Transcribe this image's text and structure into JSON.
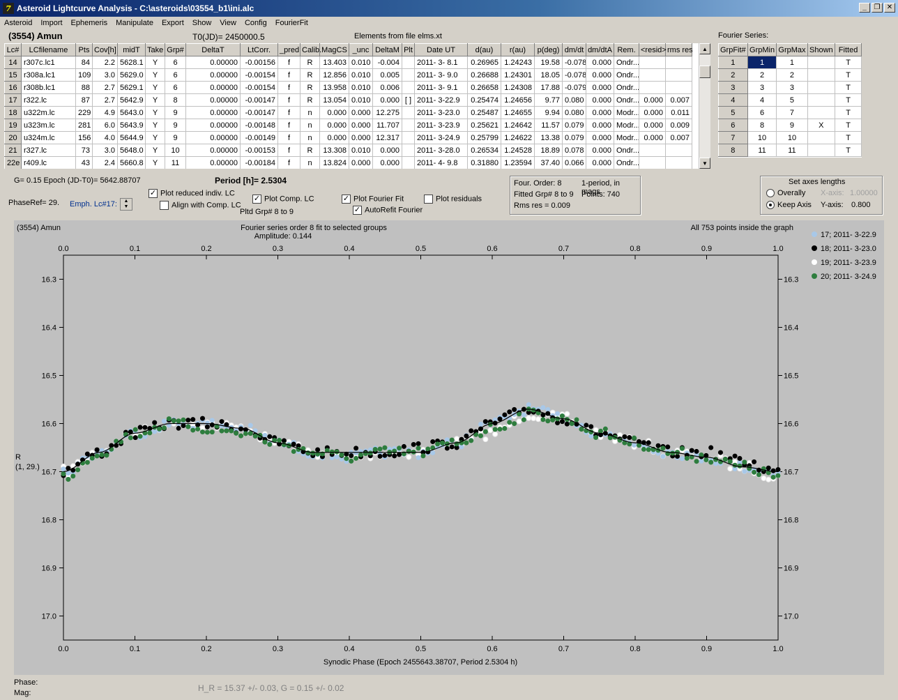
{
  "window": {
    "title": "Asteroid Lightcurve Analysis - C:\\asteroids\\03554_b1\\ini.alc"
  },
  "menu": [
    "Asteroid",
    "Import",
    "Ephemeris",
    "Manipulate",
    "Export",
    "Show",
    "View",
    "Config",
    "FourierFit"
  ],
  "header": {
    "asteroid": "(3554) Amun",
    "t0": "T0(JD)= 2450000.5",
    "elements": "Elements from file elms.xt",
    "fourier_label": "Fourier Series:"
  },
  "lc_table": {
    "columns": [
      "Lc#",
      "LCfilename",
      "Pts",
      "Cov[h]",
      "midT",
      "Take",
      "Grp#",
      "DeltaT",
      "LtCorr.",
      "_pred",
      "Calib.",
      "MagCS",
      "_unc",
      "DeltaM",
      "Plt",
      "Date UT",
      "d(au)",
      "r(au)",
      "p(deg)",
      "dm/dt",
      "dm/dtA",
      "Rem.",
      "<resid>",
      "rms res"
    ],
    "rows": [
      [
        "14",
        "r307c.lc1",
        "84",
        "2.2",
        "5628.1",
        "Y",
        "6",
        "0.00000",
        "-0.00156",
        "f",
        "R",
        "13.403",
        "0.010",
        "-0.004",
        "",
        "2011- 3- 8.1",
        "0.26965",
        "1.24243",
        "19.58",
        "-0.078",
        "0.000",
        "Ondr...",
        "",
        ""
      ],
      [
        "15",
        "r308a.lc1",
        "109",
        "3.0",
        "5629.0",
        "Y",
        "6",
        "0.00000",
        "-0.00154",
        "f",
        "R",
        "12.856",
        "0.010",
        "0.005",
        "",
        "2011- 3- 9.0",
        "0.26688",
        "1.24301",
        "18.05",
        "-0.078",
        "0.000",
        "Ondr...",
        "",
        ""
      ],
      [
        "16",
        "r308b.lc1",
        "88",
        "2.7",
        "5629.1",
        "Y",
        "6",
        "0.00000",
        "-0.00154",
        "f",
        "R",
        "13.958",
        "0.010",
        "0.006",
        "",
        "2011- 3- 9.1",
        "0.26658",
        "1.24308",
        "17.88",
        "-0.079",
        "0.000",
        "Ondr...",
        "",
        ""
      ],
      [
        "17",
        "r322.lc",
        "87",
        "2.7",
        "5642.9",
        "Y",
        "8",
        "0.00000",
        "-0.00147",
        "f",
        "R",
        "13.054",
        "0.010",
        "0.000",
        "[ ]",
        "2011- 3-22.9",
        "0.25474",
        "1.24656",
        "9.77",
        "0.080",
        "0.000",
        "Ondr...",
        "0.000",
        "0.007"
      ],
      [
        "18",
        "u322m.lc",
        "229",
        "4.9",
        "5643.0",
        "Y",
        "9",
        "0.00000",
        "-0.00147",
        "f",
        "n",
        "0.000",
        "0.000",
        "12.275",
        "",
        "2011- 3-23.0",
        "0.25487",
        "1.24655",
        "9.94",
        "0.080",
        "0.000",
        "Modr...",
        "0.000",
        "0.011"
      ],
      [
        "19",
        "u323m.lc",
        "281",
        "6.0",
        "5643.9",
        "Y",
        "9",
        "0.00000",
        "-0.00148",
        "f",
        "n",
        "0.000",
        "0.000",
        "11.707",
        "",
        "2011- 3-23.9",
        "0.25621",
        "1.24642",
        "11.57",
        "0.079",
        "0.000",
        "Modr...",
        "0.000",
        "0.009"
      ],
      [
        "20",
        "u324m.lc",
        "156",
        "4.0",
        "5644.9",
        "Y",
        "9",
        "0.00000",
        "-0.00149",
        "f",
        "n",
        "0.000",
        "0.000",
        "12.317",
        "",
        "2011- 3-24.9",
        "0.25799",
        "1.24622",
        "13.38",
        "0.079",
        "0.000",
        "Modr...",
        "0.000",
        "0.007"
      ],
      [
        "21",
        "r327.lc",
        "73",
        "3.0",
        "5648.0",
        "Y",
        "10",
        "0.00000",
        "-0.00153",
        "f",
        "R",
        "13.308",
        "0.010",
        "0.000",
        "",
        "2011- 3-28.0",
        "0.26534",
        "1.24528",
        "18.89",
        "0.078",
        "0.000",
        "Ondr...",
        "",
        ""
      ],
      [
        "22e",
        "r409.lc",
        "43",
        "2.4",
        "5660.8",
        "Y",
        "11",
        "0.00000",
        "-0.00184",
        "f",
        "n",
        "13.824",
        "0.000",
        "0.000",
        "",
        "2011- 4- 9.8",
        "0.31880",
        "1.23594",
        "37.40",
        "0.066",
        "0.000",
        "Ondr...",
        "",
        ""
      ]
    ]
  },
  "fourier_table": {
    "columns": [
      "GrpFit#",
      "GrpMin",
      "GrpMax",
      "Shown",
      "Fitted"
    ],
    "rows": [
      [
        "1",
        "1",
        "1",
        "",
        "T"
      ],
      [
        "2",
        "2",
        "2",
        "",
        "T"
      ],
      [
        "3",
        "3",
        "3",
        "",
        "T"
      ],
      [
        "4",
        "4",
        "5",
        "",
        "T"
      ],
      [
        "5",
        "6",
        "7",
        "",
        "T"
      ],
      [
        "6",
        "8",
        "9",
        "X",
        "T"
      ],
      [
        "7",
        "10",
        "10",
        "",
        "T"
      ],
      [
        "8",
        "11",
        "11",
        "",
        "T"
      ]
    ]
  },
  "controls": {
    "g_epoch": "G= 0.15   Epoch (JD-T0)= 5642.88707",
    "period": "Period [h]= 2.5304",
    "phaseref": "PhaseRef= 29.",
    "emph": "Emph. Lc#17:",
    "plot_reduced": "Plot reduced indiv. LC",
    "align_comp": "Align with Comp. LC",
    "plot_comp": "Plot Comp. LC",
    "plot_fourier": "Plot Fourier Fit",
    "plot_residuals": "Plot residuals",
    "autorefit": "AutoRefit Fourier",
    "pltd_grp": "Pltd Grp#  8  to  9"
  },
  "info_box": {
    "line1a": "Four. Order:  8",
    "line1b": "1-period, in mags",
    "line2a": "Fitted Grp# 8 to 9",
    "line2b": "Points: 740",
    "line3": "Rms res     = 0.009"
  },
  "axes_box": {
    "title": "Set axes lengths",
    "overally": "Overally",
    "keep": "Keep Axis",
    "x_label": "X-axis:",
    "x_val": "1.00000",
    "y_label": "Y-axis:",
    "y_val": "0.800"
  },
  "plot": {
    "top_left": "(3554) Amun",
    "title_line1": "Fourier series order 8 fit to selected groups",
    "title_line2": "Amplitude: 0.144",
    "top_right": "All 753 points inside the graph",
    "ylabel_line1": "R",
    "ylabel_line2": "(1, 29.)",
    "xlabel": "Synodic Phase (Epoch 2455643.38707, Period 2.5304 h)"
  },
  "footer": {
    "phase": "Phase:",
    "mag": "Mag:",
    "hg": "H_R = 15.37 +/- 0.03, G = 0.15 +/- 0.02"
  },
  "chart_data": {
    "type": "scatter",
    "x_ticks": [
      "0.0",
      "0.1",
      "0.2",
      "0.3",
      "0.4",
      "0.5",
      "0.6",
      "0.7",
      "0.8",
      "0.9",
      "1.0"
    ],
    "y_ticks": [
      "16.3",
      "16.4",
      "16.5",
      "16.6",
      "16.7",
      "16.8",
      "16.9",
      "17.0"
    ],
    "xlim": [
      0.0,
      1.0
    ],
    "ylim": [
      16.25,
      17.05
    ],
    "y_inverted": true,
    "series": [
      {
        "name": "17; 2011- 3-22.9",
        "color": "#a8c8e8",
        "x": [
          0.0,
          0.05,
          0.1,
          0.15,
          0.2,
          0.25,
          0.3,
          0.35,
          0.4,
          0.45,
          0.5,
          0.55,
          0.6,
          0.65,
          0.7,
          0.75,
          0.8,
          0.85,
          0.9,
          0.95,
          1.0
        ],
        "y": [
          16.7,
          16.66,
          16.62,
          16.6,
          16.6,
          16.61,
          16.64,
          16.66,
          16.67,
          16.66,
          16.66,
          16.64,
          16.6,
          16.57,
          16.59,
          16.62,
          16.64,
          16.66,
          16.67,
          16.69,
          16.7
        ]
      },
      {
        "name": "18; 2011- 3-23.0",
        "color": "#000000",
        "x": [
          0.0,
          0.05,
          0.1,
          0.15,
          0.2,
          0.25,
          0.3,
          0.35,
          0.4,
          0.45,
          0.5,
          0.55,
          0.6,
          0.65,
          0.7,
          0.75,
          0.8,
          0.85,
          0.9,
          0.95,
          1.0
        ],
        "y": [
          16.7,
          16.66,
          16.62,
          16.6,
          16.6,
          16.61,
          16.64,
          16.66,
          16.66,
          16.66,
          16.65,
          16.64,
          16.6,
          16.57,
          16.59,
          16.62,
          16.64,
          16.66,
          16.66,
          16.68,
          16.7
        ]
      },
      {
        "name": "19; 2011- 3-23.9",
        "color": "#ffffff",
        "x": [
          0.0,
          0.05,
          0.1,
          0.15,
          0.2,
          0.25,
          0.3,
          0.35,
          0.4,
          0.45,
          0.5,
          0.55,
          0.6,
          0.65,
          0.7,
          0.75,
          0.8,
          0.85,
          0.9,
          0.95,
          1.0
        ],
        "y": [
          16.7,
          16.66,
          16.62,
          16.6,
          16.6,
          16.61,
          16.64,
          16.66,
          16.67,
          16.66,
          16.66,
          16.64,
          16.62,
          16.58,
          16.59,
          16.62,
          16.64,
          16.66,
          16.67,
          16.69,
          16.71
        ]
      },
      {
        "name": "20; 2011- 3-24.9",
        "color": "#2e7d3e",
        "x": [
          0.0,
          0.05,
          0.1,
          0.15,
          0.2,
          0.25,
          0.3,
          0.35,
          0.4,
          0.45,
          0.5,
          0.55,
          0.6,
          0.65,
          0.7,
          0.75,
          0.8,
          0.85,
          0.9,
          0.95,
          1.0
        ],
        "y": [
          16.71,
          16.66,
          16.62,
          16.6,
          16.61,
          16.62,
          16.64,
          16.66,
          16.67,
          16.66,
          16.66,
          16.64,
          16.61,
          16.58,
          16.59,
          16.62,
          16.64,
          16.66,
          16.67,
          16.69,
          16.71
        ]
      }
    ],
    "fit_curve": {
      "x": [
        0.0,
        0.05,
        0.1,
        0.15,
        0.2,
        0.25,
        0.3,
        0.35,
        0.4,
        0.45,
        0.5,
        0.55,
        0.6,
        0.65,
        0.7,
        0.75,
        0.8,
        0.85,
        0.9,
        0.95,
        1.0
      ],
      "y": [
        16.7,
        16.66,
        16.62,
        16.6,
        16.6,
        16.61,
        16.64,
        16.66,
        16.66,
        16.66,
        16.66,
        16.64,
        16.6,
        16.57,
        16.59,
        16.62,
        16.64,
        16.66,
        16.67,
        16.69,
        16.7
      ]
    },
    "legend_position": "top-right",
    "xlabel": "Synodic Phase (Epoch 2455643.38707, Period 2.5304 h)"
  }
}
